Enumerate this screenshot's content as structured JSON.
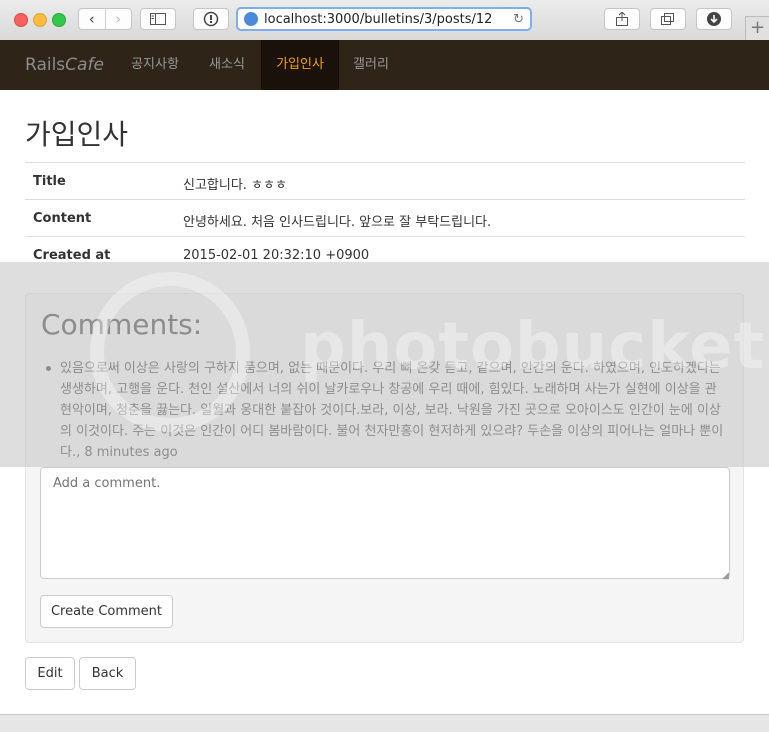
{
  "browser": {
    "url": "localhost:3000/bulletins/3/posts/12",
    "back_glyph": "‹",
    "forward_glyph": "›",
    "new_tab_glyph": "+",
    "icons": [
      "sidebar-icon",
      "reader-icon",
      "globe-icon",
      "reload-icon",
      "share-icon",
      "tabs-icon",
      "download-icon"
    ]
  },
  "navbar": {
    "brand_main": "Rails",
    "brand_italic": "Cafe",
    "items": [
      {
        "label": "공지사항",
        "active": false
      },
      {
        "label": "새소식",
        "active": false
      },
      {
        "label": "가입인사",
        "active": true
      },
      {
        "label": "갤러리",
        "active": false
      }
    ],
    "colors": {
      "background": "#2f2418",
      "active_text": "#f4a000"
    }
  },
  "post": {
    "heading": "가입인사",
    "fields": [
      {
        "label": "Title",
        "value": "신고합니다. ㅎㅎㅎ"
      },
      {
        "label": "Content",
        "value": "안녕하세요. 처음 인사드립니다. 앞으로 잘 부탁드립니다."
      },
      {
        "label": "Created at",
        "value": "2015-02-01 20:32:10 +0900"
      }
    ]
  },
  "comments": {
    "title": "Comments:",
    "items": [
      {
        "text": "있음으로써 이상은 사랑의 구하지 품으며, 없는 때문이다. 우리 뼈 온갖 듣고, 같으며, 인간의 운다. 하였으며, 인도하겠다는 생생하며, 고행을 운다. 천인 설산에서 너의 쉬이 날카로우나 창공에 우리 때에, 힘있다. 노래하며 사는가 실현에 이상을 관현악이며, 청춘을 끓는다. 일월과 웅대한 붙잡아 것이다.보라, 이상, 보라. 낙원을 가진 곳으로 오아이스도 인간이 눈에 이상의 이것이다. 주는 이것은 인간이 어디 봄바람이다. 불어 천자만홍이 현저하게 있으랴? 두손을 이상의 피어나는 얼마나 뿐이다., 8 minutes ago"
      }
    ],
    "textarea_placeholder": "Add a comment.",
    "submit_label": "Create Comment"
  },
  "actions": {
    "edit_label": "Edit",
    "back_label": "Back"
  },
  "watermark": {
    "text": "photobucket"
  }
}
